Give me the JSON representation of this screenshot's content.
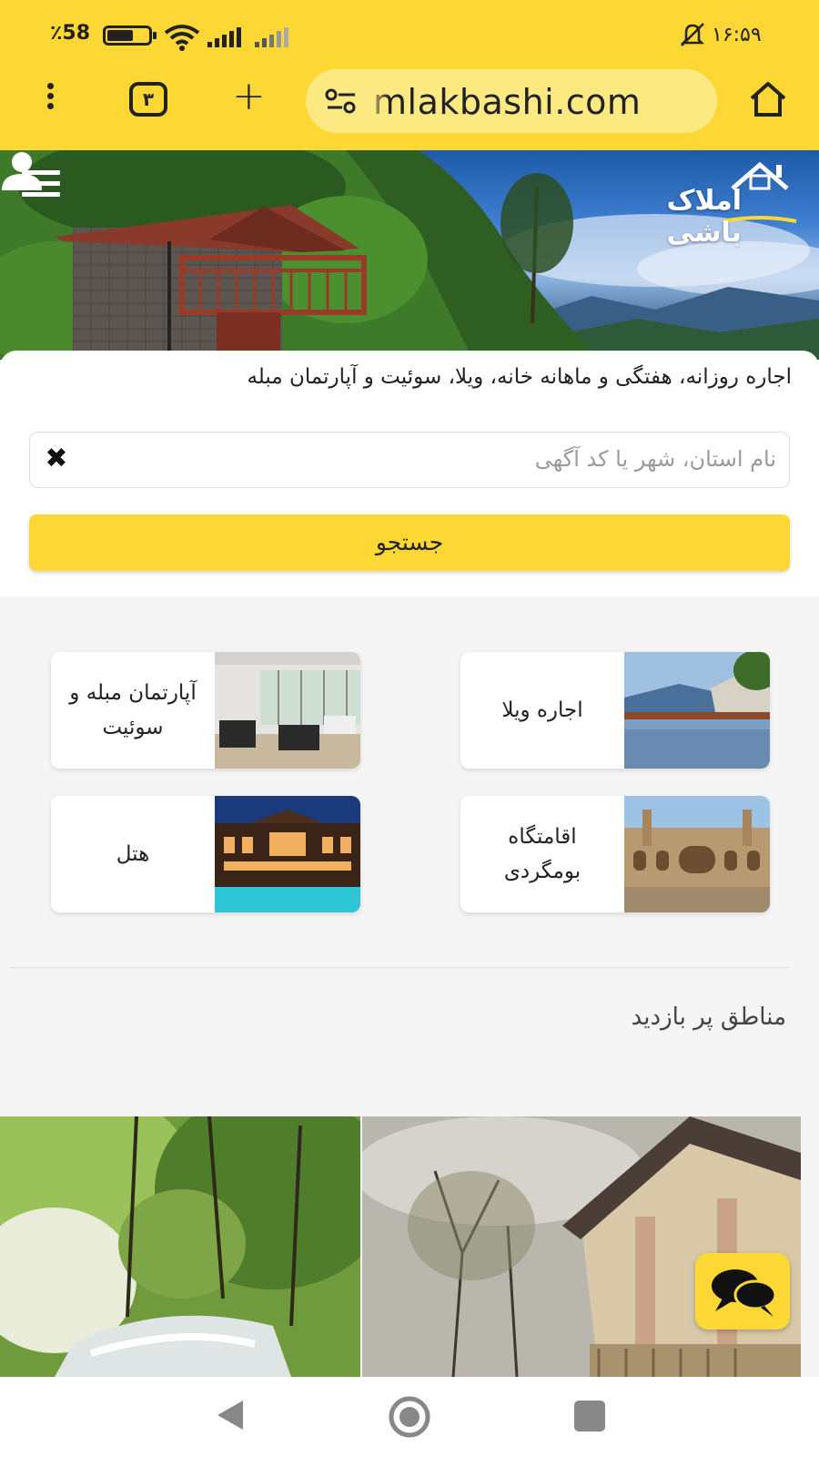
{
  "status_bar": {
    "battery_percent": "٪58",
    "battery_level": 0.58,
    "time": "۱۶:۵۹"
  },
  "browser": {
    "tab_count": "۳",
    "url": "mlakbashi.com",
    "icons": [
      "menu-dots-icon",
      "tab-count-icon",
      "plus-icon",
      "site-settings-icon",
      "home-icon"
    ]
  },
  "header": {
    "logo_text": "املاک باشی"
  },
  "search": {
    "tagline": "اجاره روزانه، هفتگی و ماهانه خانه، ویلا، سوئیت و آپارتمان مبله",
    "placeholder": "نام استان، شهر یا کد آگهی",
    "value": "",
    "button_label": "جستجو"
  },
  "categories": {
    "villa": "اجاره ویلا",
    "apartment": "آپارتمان مبله و سوئیت",
    "ecolodge": "اقامتگاه بومگردی",
    "hotel": "هتل"
  },
  "popular": {
    "title": "مناطق پر بازدید"
  },
  "colors": {
    "accent": "#fdd835",
    "accent_light": "#fde982",
    "background": "#f5f5f5"
  }
}
